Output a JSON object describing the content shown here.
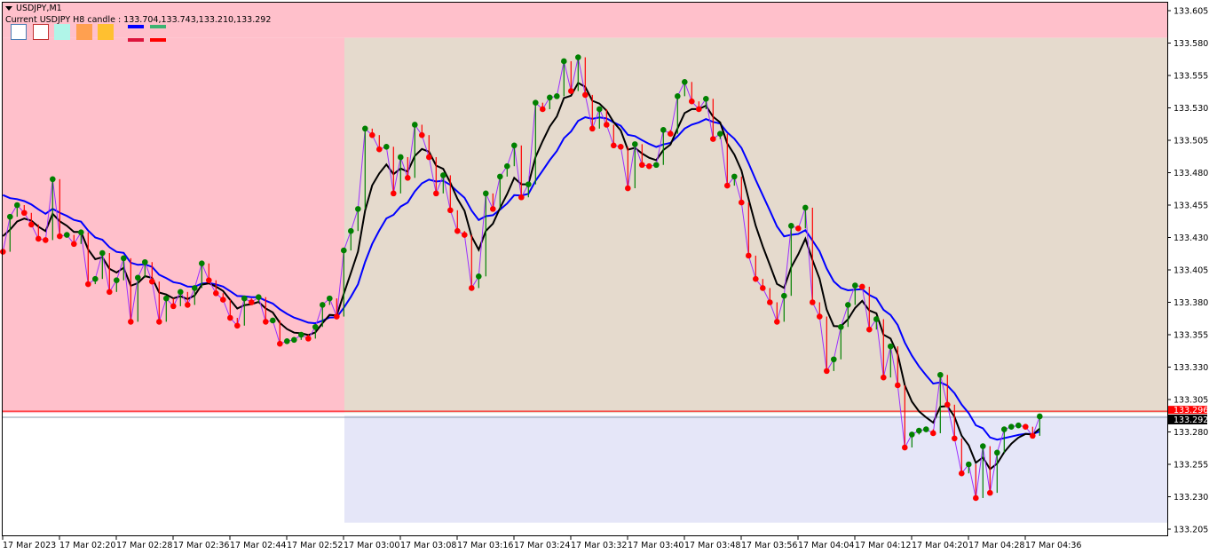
{
  "header": {
    "symbol_label": "USDJPY,M1",
    "candle_info": "Current USDJPY H8 candle : 133.704,133.743,133.210,133.292"
  },
  "legend_swatches": [
    {
      "fill": "#ffffff",
      "border": "#4a7eb5"
    },
    {
      "fill": "#ffffff",
      "border": "#c03030"
    },
    {
      "fill": "#b0f5e8",
      "border": "#b0f5e8"
    },
    {
      "fill": "#ffa050",
      "border": "#ffa050"
    },
    {
      "fill": "#ffc030",
      "border": "#ffc030"
    }
  ],
  "legend_lines": [
    "#0000ff",
    "#dc143c",
    "#3cb371",
    "#ff0000"
  ],
  "colors": {
    "upper_zone": "#ffc0cb",
    "box_zone": "#e5dacd",
    "lower_zone": "#e5e6f8",
    "up_dot": "#008000",
    "down_dot": "#ff0000",
    "close_line": "#9b30ff",
    "fast_ma": "#000000",
    "slow_ma": "#0000ff",
    "price_line": "#ff0000",
    "bid_line": "#8899aa"
  },
  "chart_data": {
    "type": "line",
    "symbol": "USDJPY",
    "timeframe": "M1",
    "ylim": [
      133.205,
      133.605
    ],
    "y_ticks": [
      "133.605",
      "133.580",
      "133.555",
      "133.530",
      "133.505",
      "133.480",
      "133.455",
      "133.430",
      "133.405",
      "133.380",
      "133.355",
      "133.330",
      "133.305",
      "133.280",
      "133.255",
      "133.230",
      "133.205"
    ],
    "x_ticks": [
      "17 Mar 2023",
      "17 Mar 02:20",
      "17 Mar 02:28",
      "17 Mar 02:36",
      "17 Mar 02:44",
      "17 Mar 02:52",
      "17 Mar 03:00",
      "17 Mar 03:08",
      "17 Mar 03:16",
      "17 Mar 03:24",
      "17 Mar 03:32",
      "17 Mar 03:40",
      "17 Mar 03:48",
      "17 Mar 03:56",
      "17 Mar 04:04",
      "17 Mar 04:12",
      "17 Mar 04:20",
      "17 Mar 04:28",
      "17 Mar 04:36"
    ],
    "closes": [
      133.419,
      133.446,
      133.455,
      133.449,
      133.44,
      133.429,
      133.428,
      133.475,
      133.431,
      133.432,
      133.425,
      133.434,
      133.394,
      133.398,
      133.418,
      133.388,
      133.397,
      133.414,
      133.365,
      133.399,
      133.411,
      133.396,
      133.365,
      133.383,
      133.377,
      133.388,
      133.378,
      133.391,
      133.41,
      133.397,
      133.387,
      133.382,
      133.368,
      133.362,
      133.383,
      133.38,
      133.384,
      133.365,
      133.366,
      133.348,
      133.35,
      133.351,
      133.355,
      133.352,
      133.361,
      133.378,
      133.383,
      133.369,
      133.42,
      133.435,
      133.452,
      133.514,
      133.509,
      133.498,
      133.5,
      133.464,
      133.492,
      133.476,
      133.517,
      133.509,
      133.492,
      133.464,
      133.478,
      133.451,
      133.435,
      133.432,
      133.391,
      133.4,
      133.464,
      133.452,
      133.477,
      133.485,
      133.501,
      133.461,
      133.471,
      133.534,
      133.529,
      133.538,
      133.539,
      133.566,
      133.543,
      133.569,
      133.54,
      133.514,
      133.529,
      133.517,
      133.501,
      133.5,
      133.468,
      133.502,
      133.486,
      133.485,
      133.486,
      133.513,
      133.51,
      133.539,
      133.55,
      133.535,
      133.529,
      133.537,
      133.506,
      133.51,
      133.47,
      133.477,
      133.457,
      133.416,
      133.398,
      133.391,
      133.38,
      133.365,
      133.385,
      133.439,
      133.437,
      133.453,
      133.38,
      133.369,
      133.327,
      133.336,
      133.361,
      133.378,
      133.393,
      133.392,
      133.359,
      133.367,
      133.322,
      133.346,
      133.316,
      133.268,
      133.278,
      133.281,
      133.282,
      133.279,
      133.324,
      133.301,
      133.275,
      133.248,
      133.255,
      133.229,
      133.269,
      133.233,
      133.264,
      133.282,
      133.284,
      133.285,
      133.284,
      133.277,
      133.292
    ],
    "zones": {
      "box_high": 133.584,
      "box_mid": 133.296,
      "box_low": 133.21
    },
    "price_labels": {
      "red_line": "133.296",
      "bid": "133.292"
    }
  }
}
